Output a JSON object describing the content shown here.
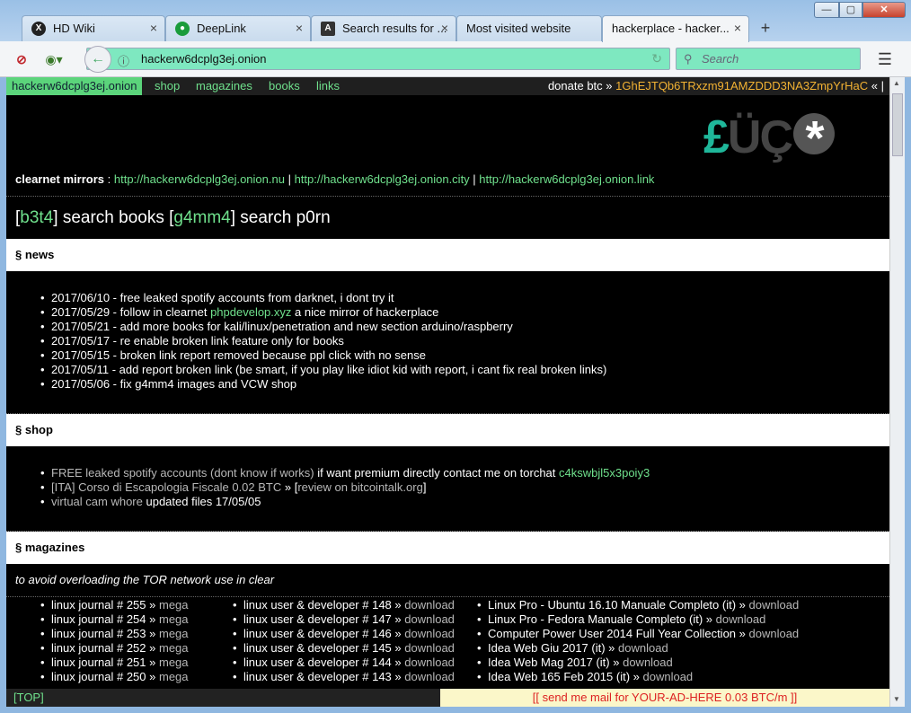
{
  "tabs": [
    {
      "label": "HD Wiki",
      "icon": "hd-wiki-icon"
    },
    {
      "label": "DeepLink",
      "icon": "deeplink-icon"
    },
    {
      "label": "Search results for ...",
      "icon": "search-results-icon"
    },
    {
      "label": "Most visited website",
      "icon": ""
    },
    {
      "label": "hackerplace - hacker...",
      "icon": "",
      "active": true
    }
  ],
  "nav": {
    "url": "hackerw6dcplg3ej.onion",
    "search_placeholder": "Search"
  },
  "site": {
    "topbar": {
      "site_link": "hackerw6dcplg3ej.onion",
      "links": [
        "shop",
        "magazines",
        "books",
        "links"
      ],
      "donate_label": "donate btc »",
      "btc_address": "1GhEJTQb6TRxzm91AMZDDD3NA3ZmpYrHaC",
      "donate_tail": "« |"
    },
    "logo": {
      "part1": "£",
      "part2": "ÜÇ",
      "star": "*"
    },
    "mirrors": {
      "label": "clearnet mirrors",
      "sep": ":",
      "links": [
        "http://hackerw6dcplg3ej.onion.nu",
        "http://hackerw6dcplg3ej.onion.city",
        "http://hackerw6dcplg3ej.onion.link"
      ]
    },
    "searchline": {
      "b3t4": "b3t4",
      "books_text": "] search books [",
      "g4mm4": "g4mm4",
      "p0rn_text": "] search p0rn",
      "open": "["
    },
    "news": {
      "heading": "§ news",
      "items": [
        "2017/06/10 - free leaked spotify accounts from darknet, i dont try it",
        "2017/05/29 - follow in clearnet ",
        "2017/05/21 - add more books for kali/linux/penetration and new section arduino/raspberry",
        "2017/05/17 - re enable broken link feature only for books",
        "2017/05/15 - broken link report removed because ppl click with no sense",
        "2017/05/11 - add report broken link (be smart, if you play like idiot kid with report, i cant fix real broken links)",
        "2017/05/06 - fix g4mm4 images and VCW shop"
      ],
      "item2_link": "phpdevelop.xyz",
      "item2_tail": " a nice mirror of hackerplace"
    },
    "shop": {
      "heading": "§ shop",
      "item1_grey": "FREE leaked spotify accounts (dont know if works)",
      "item1_white": " if want premium directly contact me on torchat ",
      "item1_torchat": "c4kswbjl5x3poiy3",
      "item2_grey": "[ITA] Corso di Escapologia Fiscale 0.02 BTC",
      "item2_white": " » [",
      "item2_link": "review on bitcointalk.org",
      "item2_close": "]",
      "item3_grey": "virtual cam whore",
      "item3_white": " updated files 17/05/05"
    },
    "magazines": {
      "heading": "§ magazines",
      "note": "to avoid overloading the TOR network use in clear",
      "col1": [
        {
          "title": "linux journal # 255",
          "link": "mega"
        },
        {
          "title": "linux journal # 254",
          "link": "mega"
        },
        {
          "title": "linux journal # 253",
          "link": "mega"
        },
        {
          "title": "linux journal # 252",
          "link": "mega"
        },
        {
          "title": "linux journal # 251",
          "link": "mega"
        },
        {
          "title": "linux journal # 250",
          "link": "mega"
        }
      ],
      "col2": [
        {
          "title": "linux user & developer # 148",
          "link": "download"
        },
        {
          "title": "linux user & developer # 147",
          "link": "download"
        },
        {
          "title": "linux user & developer # 146",
          "link": "download"
        },
        {
          "title": "linux user & developer # 145",
          "link": "download"
        },
        {
          "title": "linux user & developer # 144",
          "link": "download"
        },
        {
          "title": "linux user & developer # 143",
          "link": "download"
        }
      ],
      "col3": [
        {
          "title": "Linux Pro - Ubuntu 16.10 Manuale Completo (it)",
          "link": "download"
        },
        {
          "title": "Linux Pro - Fedora Manuale Completo (it)",
          "link": "download"
        },
        {
          "title": "Computer Power User 2014 Full Year Collection",
          "link": "download"
        },
        {
          "title": "Idea Web Giu 2017 (it)",
          "link": "download"
        },
        {
          "title": "Idea Web Mag 2017 (it)",
          "link": "download"
        },
        {
          "title": "Idea Web 165 Feb 2015 (it)",
          "link": "download"
        }
      ],
      "sep": " » "
    },
    "bottom": {
      "top_link": "[TOP]",
      "ad_text": "[[ send me mail for YOUR-AD-HERE 0.03 BTC/m ]]"
    }
  },
  "colors": {
    "green": "#6fe08c",
    "btc": "#f2b233",
    "teal": "#1fb79a",
    "url_bg": "#7ee8c0"
  }
}
